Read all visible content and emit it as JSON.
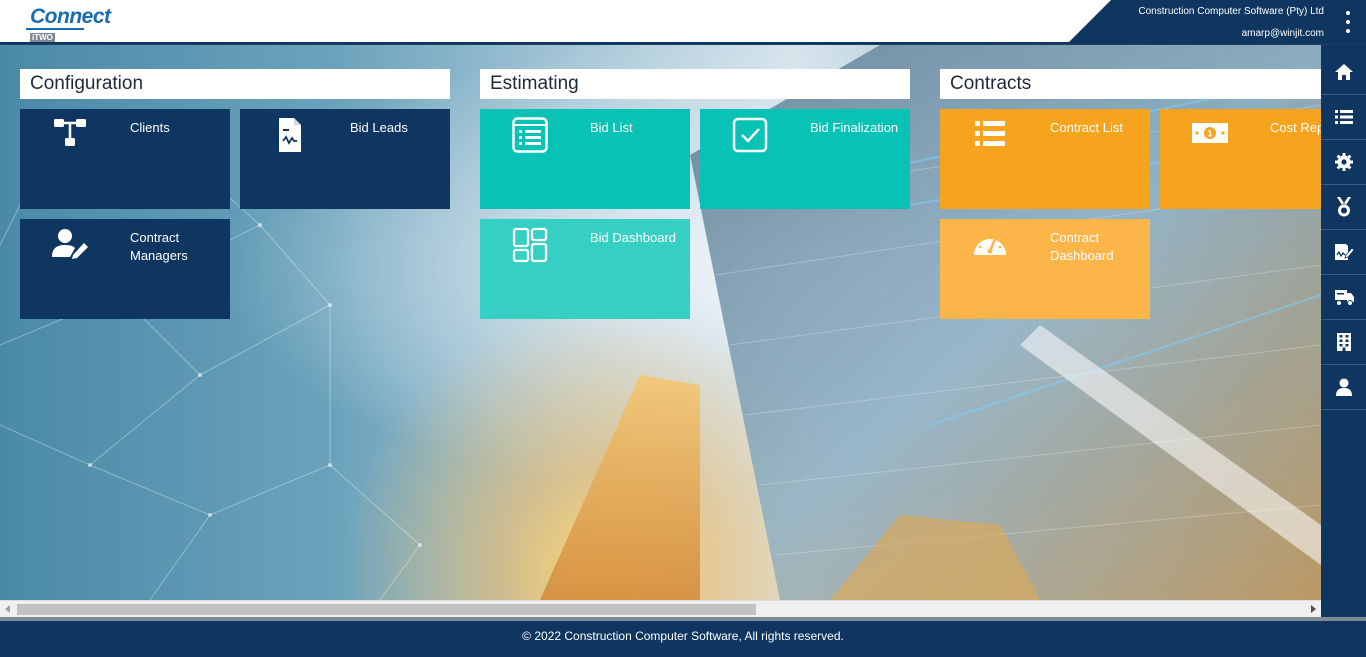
{
  "header": {
    "logo_main": "Connect",
    "logo_sub": "iTWO",
    "company": "Construction Computer Software (Pty) Ltd",
    "email": "amarp@winjit.com",
    "menu_icon": "kebab-menu-icon"
  },
  "sections": {
    "configuration": {
      "title": "Configuration",
      "tiles": [
        {
          "label": "Clients",
          "icon": "hierarchy-icon"
        },
        {
          "label": "Bid Leads",
          "icon": "document-signature-icon"
        },
        {
          "label": "Contract Managers",
          "icon": "user-edit-icon"
        }
      ]
    },
    "estimating": {
      "title": "Estimating",
      "tiles": [
        {
          "label": "Bid List",
          "icon": "list-document-icon"
        },
        {
          "label": "Bid Finalization",
          "icon": "checkbox-icon"
        },
        {
          "label": "Bid Dashboard",
          "icon": "dashboard-layout-icon"
        }
      ]
    },
    "contracts": {
      "title": "Contracts",
      "tiles": [
        {
          "label": "Contract List",
          "icon": "bulleted-list-icon"
        },
        {
          "label": "Cost Reports",
          "icon": "money-bill-icon"
        },
        {
          "label": "Contract Dashboard",
          "icon": "speedometer-icon"
        }
      ]
    }
  },
  "sidebar": {
    "items": [
      {
        "icon": "home-icon"
      },
      {
        "icon": "list-icon"
      },
      {
        "icon": "gear-icon"
      },
      {
        "icon": "medal-icon"
      },
      {
        "icon": "signature-icon"
      },
      {
        "icon": "truck-icon"
      },
      {
        "icon": "building-icon"
      },
      {
        "icon": "user-icon"
      }
    ]
  },
  "footer": {
    "copyright": "© 2022 Construction Computer Software, All rights reserved."
  },
  "colors": {
    "navy": "#0e3660",
    "teal": "#08c2b5",
    "teal_light": "#35d0c3",
    "orange": "#f6a31e",
    "orange_light": "#fbb548"
  }
}
